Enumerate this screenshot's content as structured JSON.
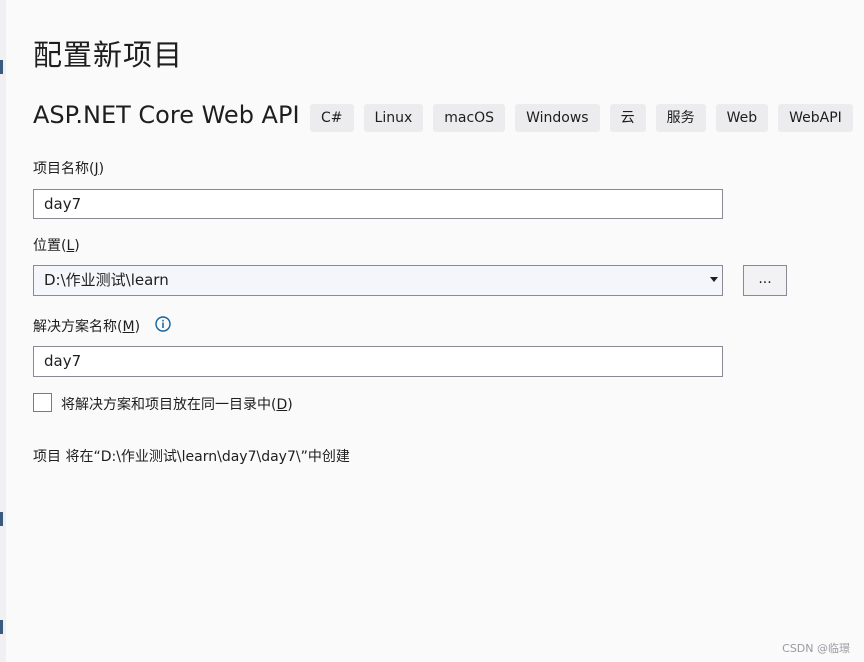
{
  "page": {
    "title": "配置新项目",
    "template_name": "ASP.NET Core Web API",
    "tags": [
      "C#",
      "Linux",
      "macOS",
      "Windows",
      "云",
      "服务",
      "Web",
      "WebAPI"
    ]
  },
  "form": {
    "project_name": {
      "label": "项目名称",
      "mnemonic": "J",
      "value": "day7"
    },
    "location": {
      "label": "位置",
      "mnemonic": "L",
      "value": "D:\\作业测试\\learn",
      "browse_label": "..."
    },
    "solution_name": {
      "label": "解决方案名称",
      "mnemonic": "M",
      "value": "day7"
    },
    "same_dir": {
      "label": "将解决方案和项目放在同一目录中",
      "mnemonic": "D",
      "checked": false
    }
  },
  "footer_text": "项目 将在“D:\\作业测试\\learn\\day7\\day7\\”中创建",
  "watermark": "CSDN @临璟",
  "colors": {
    "accent": "#0e639c",
    "background": "#fafafb",
    "input_border": "#8a8a94"
  }
}
